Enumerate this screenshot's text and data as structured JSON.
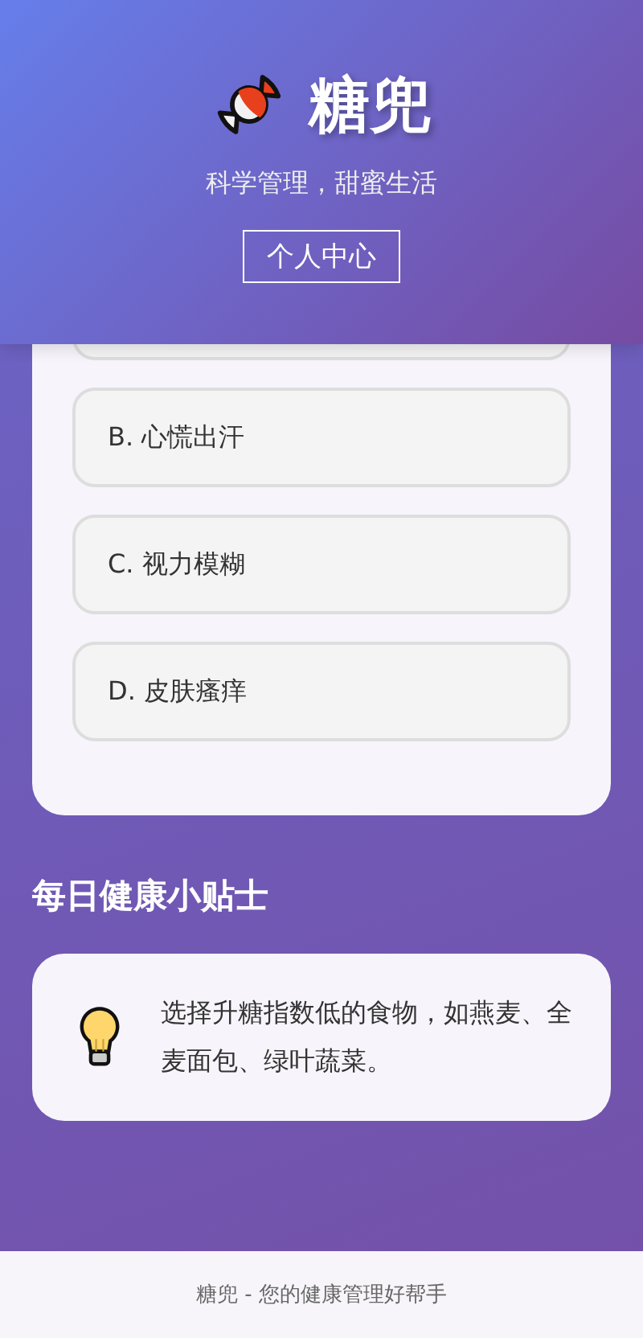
{
  "header": {
    "title": "糖兜",
    "tagline": "科学管理，甜蜜生活",
    "profile_button": "个人中心"
  },
  "quiz": {
    "options": [
      {
        "label": "B. 心慌出汗"
      },
      {
        "label": "C. 视力模糊"
      },
      {
        "label": "D. 皮肤瘙痒"
      }
    ]
  },
  "tips": {
    "heading": "每日健康小贴士",
    "text": "选择升糖指数低的食物，如燕麦、全麦面包、绿叶蔬菜。"
  },
  "footer": {
    "text": "糖兜 - 您的健康管理好帮手"
  }
}
